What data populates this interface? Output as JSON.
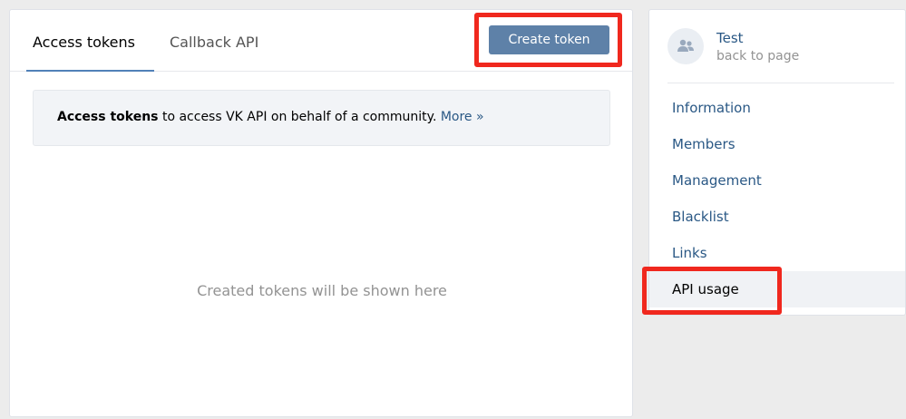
{
  "tabs": [
    {
      "label": "Access tokens",
      "active": true
    },
    {
      "label": "Callback API",
      "active": false
    }
  ],
  "create_button": {
    "label": "Create token"
  },
  "info": {
    "bold": "Access tokens",
    "text": " to access VK API on behalf of a community. ",
    "more": "More »"
  },
  "empty_state": "Created tokens will be shown here",
  "sidebar": {
    "title": "Test",
    "back": "back to page",
    "items": [
      {
        "label": "Information"
      },
      {
        "label": "Members"
      },
      {
        "label": "Management"
      },
      {
        "label": "Blacklist"
      },
      {
        "label": "Links"
      },
      {
        "label": "API usage",
        "active": true
      }
    ]
  },
  "colors": {
    "accent": "#5181b8",
    "button": "#5e81a8",
    "link": "#2a5885",
    "highlight": "#f0281e"
  },
  "icons": {
    "avatar": "group-icon"
  }
}
